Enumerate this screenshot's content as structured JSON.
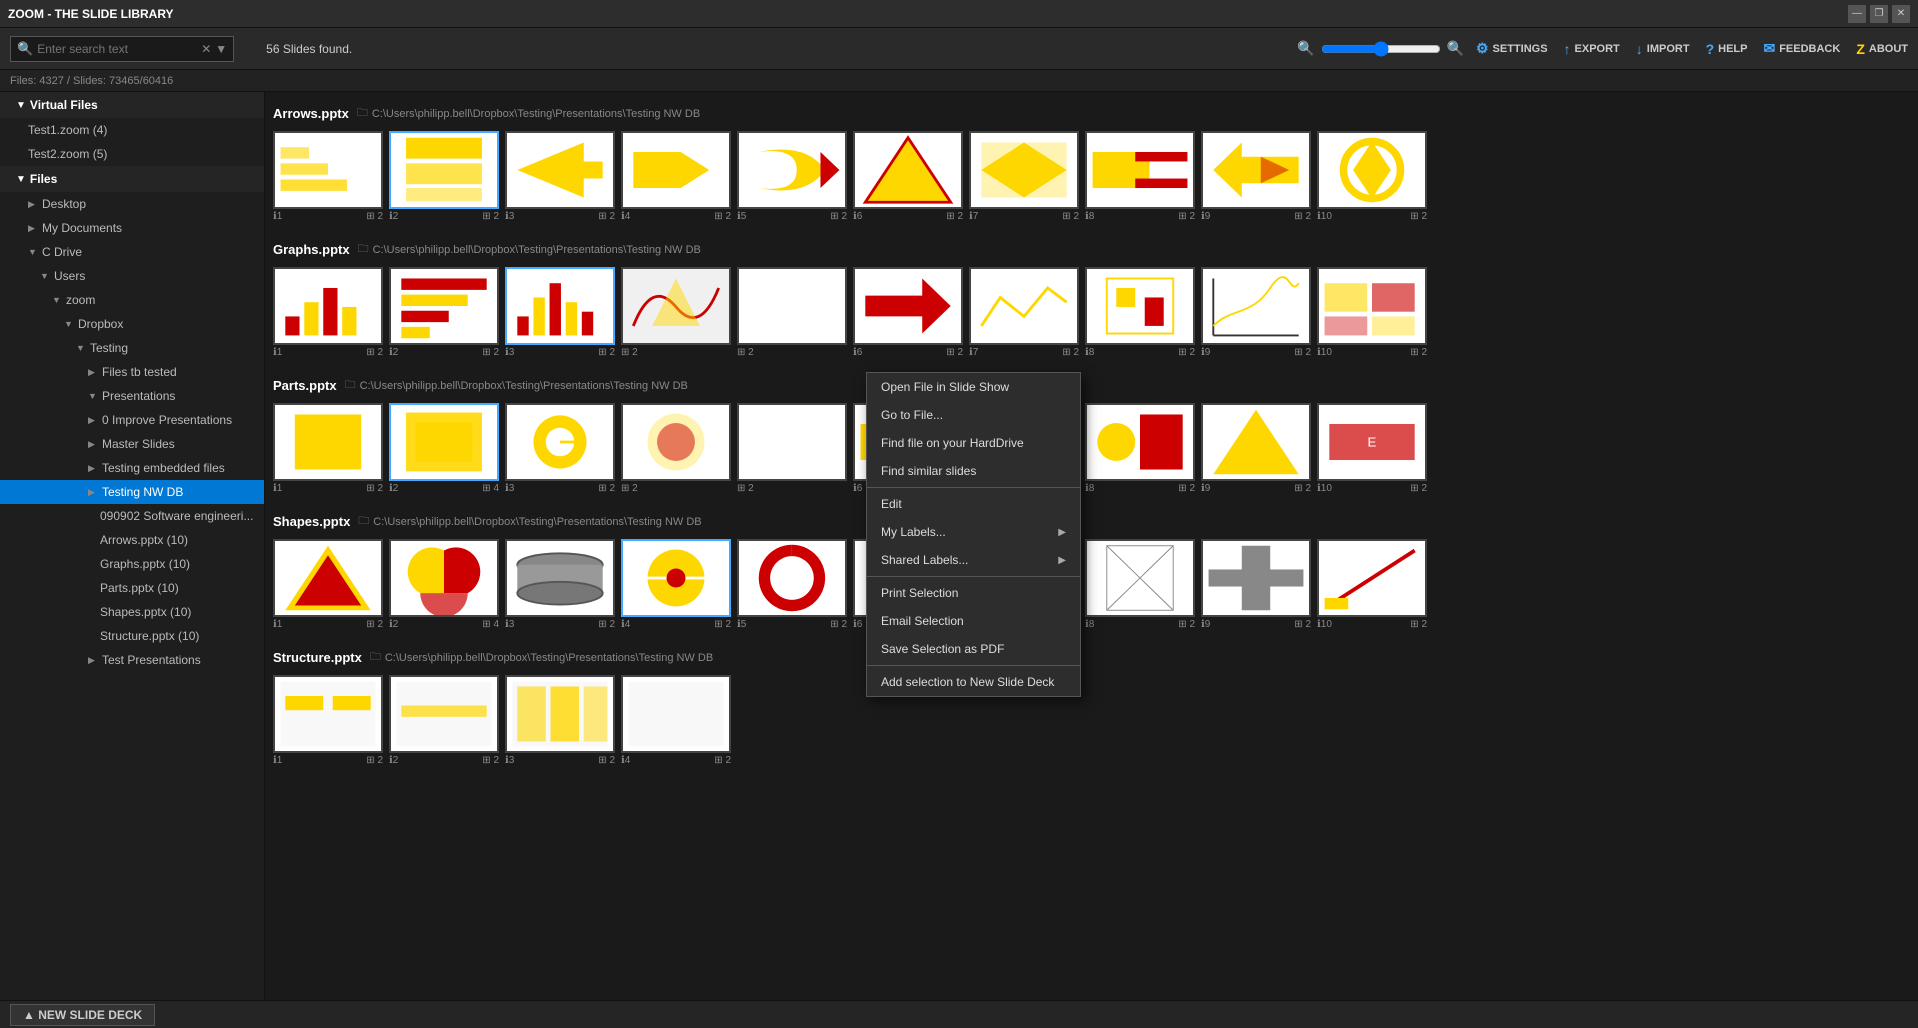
{
  "titleBar": {
    "title": "ZOOM - THE SLIDE LIBRARY",
    "winControls": [
      "—",
      "❐",
      "✕"
    ]
  },
  "toolbar": {
    "searchPlaceholder": "Enter search text",
    "slidesFound": "56 Slides found.",
    "actions": [
      {
        "id": "settings",
        "label": "SETTINGS",
        "icon": "⚙"
      },
      {
        "id": "export",
        "label": "EXPORT",
        "icon": "↑"
      },
      {
        "id": "import",
        "label": "IMPORT",
        "icon": "↓"
      },
      {
        "id": "help",
        "label": "HELP",
        "icon": "?"
      },
      {
        "id": "feedback",
        "label": "FEEDBACK",
        "icon": "✉"
      },
      {
        "id": "about",
        "label": "ABOUT",
        "icon": "Z"
      }
    ]
  },
  "filesInfo": "Files: 4327 / Slides: 73465/60416",
  "sidebar": {
    "virtualFiles": {
      "label": "Virtual Files",
      "items": [
        {
          "label": "Test1.zoom (4)",
          "indent": 2
        },
        {
          "label": "Test2.zoom (5)",
          "indent": 2
        }
      ]
    },
    "files": {
      "label": "Files",
      "items": [
        {
          "label": "Desktop",
          "indent": 2,
          "arrow": "▶"
        },
        {
          "label": "My Documents",
          "indent": 2,
          "arrow": "▶"
        },
        {
          "label": "C Drive",
          "indent": 2,
          "arrow": "▼"
        },
        {
          "label": "Users",
          "indent": 3,
          "arrow": "▼"
        },
        {
          "label": "zoom",
          "indent": 4,
          "arrow": "▼"
        },
        {
          "label": "Dropbox",
          "indent": 5,
          "arrow": "▼"
        },
        {
          "label": "Testing",
          "indent": 6,
          "arrow": "▼"
        },
        {
          "label": "Files tb tested",
          "indent": 7,
          "arrow": "▶"
        },
        {
          "label": "Presentations",
          "indent": 7,
          "arrow": "▼"
        },
        {
          "label": "0 Improve Presentations",
          "indent": 8,
          "arrow": "▶"
        },
        {
          "label": "Master Slides",
          "indent": 8,
          "arrow": "▶"
        },
        {
          "label": "Testing embedded files",
          "indent": 8,
          "arrow": "▶"
        },
        {
          "label": "Testing NW DB",
          "indent": 8,
          "arrow": "▶",
          "active": true
        },
        {
          "label": "090902 Software engineeri...",
          "indent": 9
        },
        {
          "label": "Arrows.pptx (10)",
          "indent": 9
        },
        {
          "label": "Graphs.pptx (10)",
          "indent": 9
        },
        {
          "label": "Parts.pptx (10)",
          "indent": 9
        },
        {
          "label": "Shapes.pptx (10)",
          "indent": 9
        },
        {
          "label": "Structure.pptx (10)",
          "indent": 9
        },
        {
          "label": "Test Presentations",
          "indent": 7,
          "arrow": "▶"
        }
      ]
    }
  },
  "sections": [
    {
      "title": "Arrows.pptx",
      "path": "C:\\Users\\philipp.bell\\Dropbox\\Testing\\Presentations\\Testing NW DB",
      "slideCount": 10
    },
    {
      "title": "Graphs.pptx",
      "path": "C:\\Users\\philipp.bell\\Dropbox\\Testing\\Presentations\\Testing NW DB",
      "slideCount": 10
    },
    {
      "title": "Parts.pptx",
      "path": "C:\\Users\\philipp.bell\\Dropbox\\Testing\\Presentations\\Testing NW DB",
      "slideCount": 10
    },
    {
      "title": "Shapes.pptx",
      "path": "C:\\Users\\philipp.bell\\Dropbox\\Testing\\Presentations\\Testing NW DB",
      "slideCount": 10
    },
    {
      "title": "Structure.pptx",
      "path": "C:\\Users\\philipp.bell\\Dropbox\\Testing\\Presentations\\Testing NW DB",
      "slideCount": 4
    }
  ],
  "contextMenu": {
    "items": [
      {
        "label": "Open File in Slide Show",
        "type": "item"
      },
      {
        "label": "Go to File...",
        "type": "item"
      },
      {
        "label": "Find file on your HardDrive",
        "type": "item"
      },
      {
        "label": "Find similar slides",
        "type": "item"
      },
      {
        "type": "separator"
      },
      {
        "label": "Edit",
        "type": "item"
      },
      {
        "label": "My Labels...",
        "type": "item",
        "arrow": true
      },
      {
        "label": "Shared Labels...",
        "type": "item",
        "arrow": true
      },
      {
        "type": "separator"
      },
      {
        "label": "Print Selection",
        "type": "item"
      },
      {
        "label": "Email Selection",
        "type": "item"
      },
      {
        "label": "Save Selection as PDF",
        "type": "item"
      },
      {
        "type": "separator"
      },
      {
        "label": "Add selection to New Slide Deck",
        "type": "item"
      }
    ]
  },
  "bottomBar": {
    "label": "▲ NEW SLIDE DECK"
  }
}
